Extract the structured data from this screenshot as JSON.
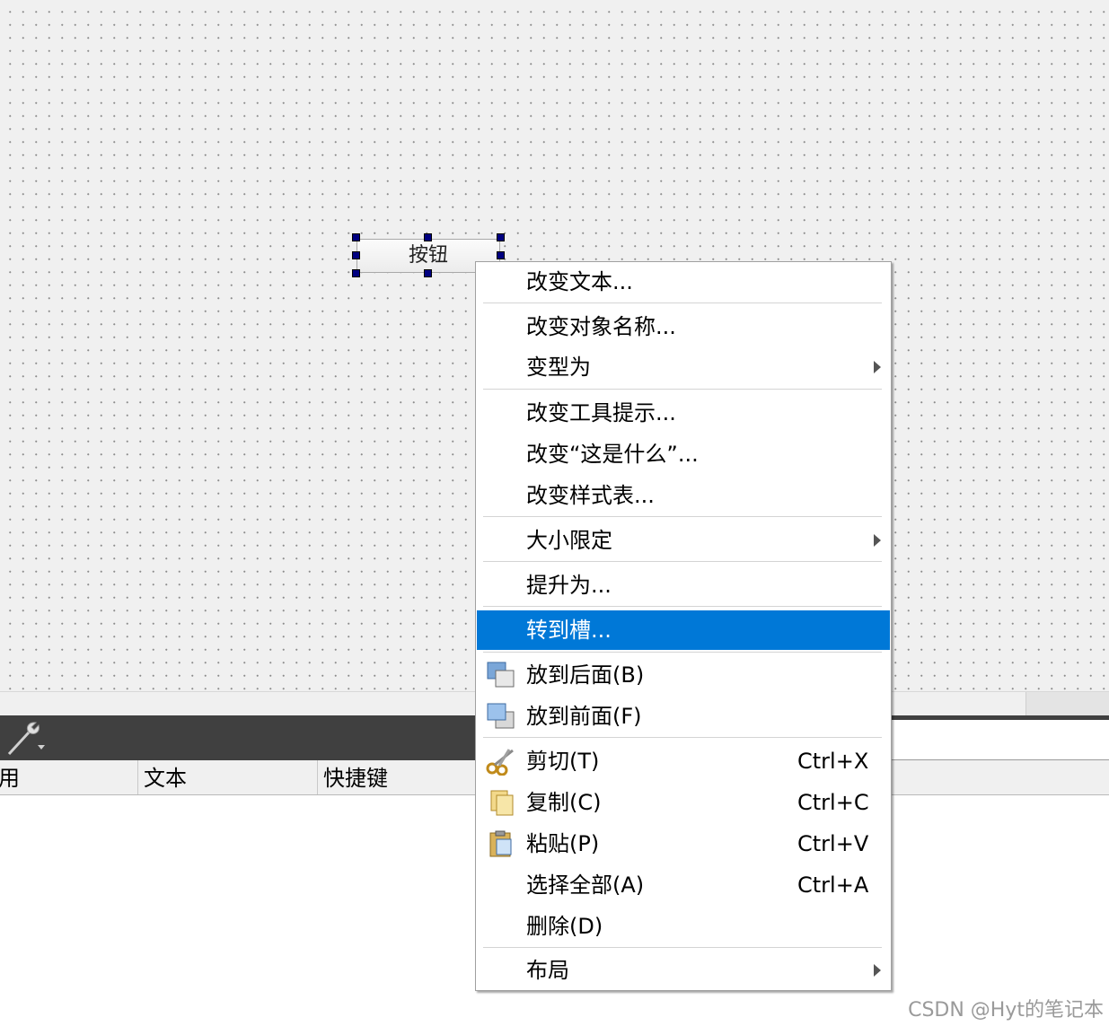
{
  "form_widget": {
    "button_text": "按钮"
  },
  "action_editor": {
    "columns": [
      "用",
      "文本",
      "快捷键"
    ]
  },
  "context_menu": {
    "items": [
      {
        "label": "改变文本...",
        "shortcut": "",
        "submenu": false
      },
      {
        "label": "改变对象名称...",
        "shortcut": "",
        "submenu": false
      },
      {
        "label": "变型为",
        "shortcut": "",
        "submenu": true
      },
      {
        "label": "改变工具提示...",
        "shortcut": "",
        "submenu": false
      },
      {
        "label": "改变“这是什么”...",
        "shortcut": "",
        "submenu": false
      },
      {
        "label": "改变样式表...",
        "shortcut": "",
        "submenu": false
      },
      {
        "label": "大小限定",
        "shortcut": "",
        "submenu": true
      },
      {
        "label": "提升为...",
        "shortcut": "",
        "submenu": false
      },
      {
        "label": "转到槽...",
        "shortcut": "",
        "submenu": false,
        "highlighted": true
      },
      {
        "label": "放到后面(B)",
        "shortcut": "",
        "submenu": false,
        "icon": "send-to-back-icon"
      },
      {
        "label": "放到前面(F)",
        "shortcut": "",
        "submenu": false,
        "icon": "bring-to-front-icon"
      },
      {
        "label": "剪切(T)",
        "shortcut": "Ctrl+X",
        "submenu": false,
        "icon": "scissors-icon"
      },
      {
        "label": "复制(C)",
        "shortcut": "Ctrl+C",
        "submenu": false,
        "icon": "copy-icon"
      },
      {
        "label": "粘贴(P)",
        "shortcut": "Ctrl+V",
        "submenu": false,
        "icon": "paste-icon"
      },
      {
        "label": "选择全部(A)",
        "shortcut": "Ctrl+A",
        "submenu": false
      },
      {
        "label": "删除(D)",
        "shortcut": "",
        "submenu": false
      },
      {
        "label": "布局",
        "shortcut": "",
        "submenu": true
      }
    ]
  },
  "watermark": "CSDN @Hyt的笔记本",
  "colors": {
    "highlight": "#0078d7",
    "selection_handle": "#000080",
    "toolbar_bg": "#404040"
  }
}
